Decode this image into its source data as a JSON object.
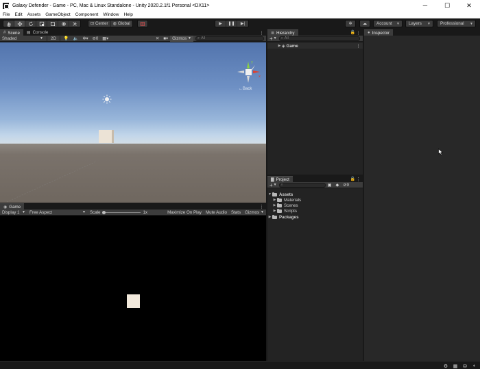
{
  "window": {
    "title": "Galaxy Defender - Game - PC, Mac & Linux Standalone - Unity 2020.2.1f1 Personal <DX11>",
    "minimize": "─",
    "maximize": "☐",
    "close": "✕"
  },
  "menu": [
    "File",
    "Edit",
    "Assets",
    "GameObject",
    "Component",
    "Window",
    "Help"
  ],
  "toolbar": {
    "pivot_label": "Center",
    "space_label": "Global",
    "account_label": "Account",
    "layers_label": "Layers",
    "layout_label": "Professional"
  },
  "scene_panel": {
    "tabs": [
      "Scene",
      "Console"
    ],
    "shading_mode": "Shaded",
    "mode_2d": "2D",
    "fx_count": "0",
    "gizmos_label": "Gizmos",
    "search_placeholder": "All",
    "back_label": "←Back"
  },
  "game_panel": {
    "tab": "Game",
    "display": "Display 1",
    "aspect": "Free Aspect",
    "scale_label": "Scale",
    "scale_value": "1x",
    "maximize_on_play": "Maximize On Play",
    "mute_audio": "Mute Audio",
    "stats": "Stats",
    "gizmos_label": "Gizmos"
  },
  "hierarchy": {
    "tab": "Hierarchy",
    "search_placeholder": "All",
    "scene_name": "Game"
  },
  "project": {
    "tab": "Project",
    "hidden_count": "9",
    "tree": {
      "assets": "Assets",
      "children": [
        "Materials",
        "Scenes",
        "Scripts"
      ],
      "packages": "Packages"
    }
  },
  "inspector": {
    "tab": "Inspector"
  },
  "colors": {
    "sky_top": "#5274ad",
    "horizon": "#d2dde6",
    "ground": "#6f675f",
    "cube": "#e8dccb",
    "panel_bg": "#232323"
  }
}
